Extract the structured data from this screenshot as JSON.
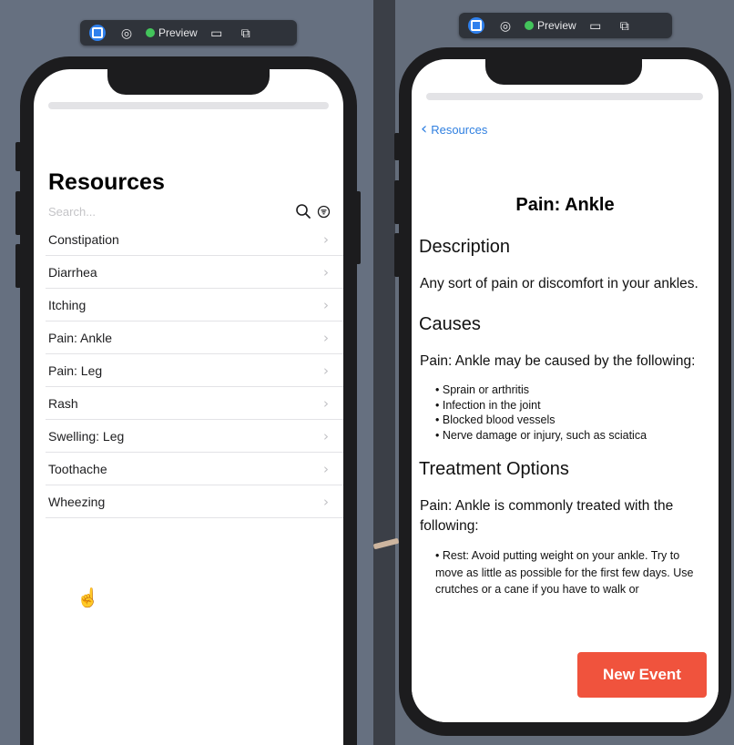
{
  "toolbar": {
    "preview_label": "Preview"
  },
  "resources_list": {
    "title": "Resources",
    "search_placeholder": "Search...",
    "items": [
      {
        "label": "Constipation"
      },
      {
        "label": "Diarrhea"
      },
      {
        "label": "Itching"
      },
      {
        "label": "Pain: Ankle"
      },
      {
        "label": "Pain: Leg"
      },
      {
        "label": "Rash"
      },
      {
        "label": "Swelling: Leg"
      },
      {
        "label": "Toothache"
      },
      {
        "label": "Wheezing"
      }
    ]
  },
  "detail": {
    "back_label": "Resources",
    "title": "Pain: Ankle",
    "description_heading": "Description",
    "description_text": "Any sort of pain or discomfort in your ankles.",
    "causes_heading": "Causes",
    "causes_intro": "Pain: Ankle may be caused by the following:",
    "causes": [
      "Sprain or arthritis",
      "Infection in the joint",
      "Blocked blood vessels",
      "Nerve damage or injury, such as sciatica"
    ],
    "treatment_heading": "Treatment Options",
    "treatment_intro": "Pain: Ankle is commonly treated with the following:",
    "treatment_text": "• Rest: Avoid putting weight on your ankle. Try to move as little as possible for the first few days. Use crutches or a cane if you have to walk or",
    "new_event_label": "New Event"
  },
  "colors": {
    "accent_blue": "#2f7fe0",
    "new_event_red": "#f0533d",
    "preview_green": "#43c45b"
  }
}
